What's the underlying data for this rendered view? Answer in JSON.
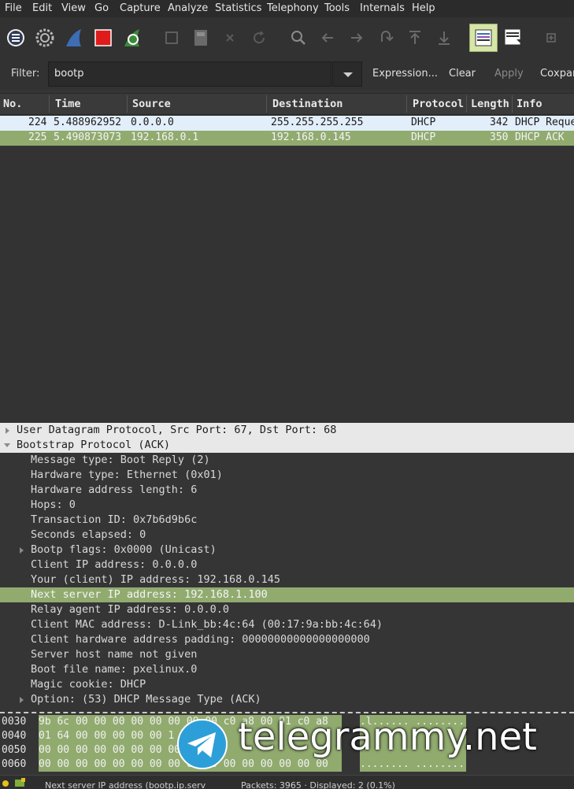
{
  "menu": [
    "File",
    "Edit",
    "View",
    "Go",
    "Capture",
    "Analyze",
    "Statistics",
    "Telephony",
    "Tools",
    "Internals",
    "Help"
  ],
  "filter": {
    "label": "Filter:",
    "value": "bootp",
    "expression": "Expression...",
    "clear": "Clear",
    "apply": "Apply",
    "save": "Сохран"
  },
  "packet_list": {
    "columns": [
      "No.",
      "Time",
      "Source",
      "Destination",
      "Protocol",
      "Length",
      "Info"
    ],
    "rows": [
      {
        "no": "224",
        "time": "5.488962952",
        "source": "0.0.0.0",
        "destination": "255.255.255.255",
        "protocol": "DHCP",
        "length": "342",
        "info": "DHCP Reque"
      },
      {
        "no": "225",
        "time": "5.490873073",
        "source": "192.168.0.1",
        "destination": "192.168.0.145",
        "protocol": "DHCP",
        "length": "350",
        "info": "DHCP ACK"
      }
    ]
  },
  "details": {
    "udp": "User Datagram Protocol, Src Port: 67, Dst Port: 68",
    "bootp": "Bootstrap Protocol (ACK)",
    "fields": [
      "Message type: Boot Reply (2)",
      "Hardware type: Ethernet (0x01)",
      "Hardware address length: 6",
      "Hops: 0",
      "Transaction ID: 0x7b6d9b6c",
      "Seconds elapsed: 0",
      "Bootp flags: 0x0000 (Unicast)",
      "Client IP address: 0.0.0.0",
      "Your (client) IP address: 192.168.0.145",
      "Next server IP address: 192.168.1.100",
      "Relay agent IP address: 0.0.0.0",
      "Client MAC address: D-Link_bb:4c:64 (00:17:9a:bb:4c:64)",
      "Client hardware address padding: 00000000000000000000",
      "Server host name not given",
      "Boot file name: pxelinux.0",
      "Magic cookie: DHCP",
      "Option: (53) DHCP Message Type (ACK)"
    ]
  },
  "bytes": {
    "rows": [
      {
        "offset": "0030",
        "hex": "9b 6c 00 00 00 00 00 00  00 00 c0 a8 00 91 c0 a8",
        "ascii": ".l...... ........"
      },
      {
        "offset": "0040",
        "hex": "01 64 00 00 00 00 00 1",
        "ascii": ""
      },
      {
        "offset": "0050",
        "hex": "00 00 00 00 00 00 00 00",
        "ascii": ""
      },
      {
        "offset": "0060",
        "hex": "00 00 00 00 00 00 00 00  00 00 00 00 00 00 00 00",
        "ascii": "........ ........"
      }
    ]
  },
  "watermark": "telegrammy.net",
  "status": {
    "field": "Next server IP address (bootp.ip.serv",
    "packets": "Packets: 3965 · Displayed: 2 (0.1%)"
  },
  "colors": {
    "selected_row": "#91ab6f",
    "request_row": "#e2eefa",
    "capture_stop": "#e01b1b"
  }
}
